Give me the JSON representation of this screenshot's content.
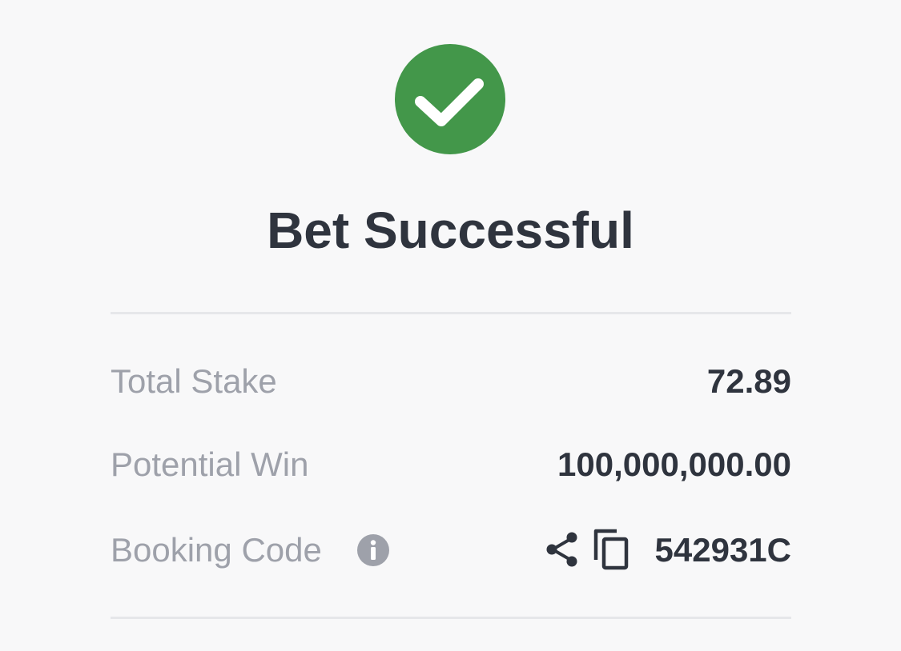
{
  "status": {
    "icon": "checkmark-circle-icon",
    "color": "#43974a",
    "title": "Bet Successful"
  },
  "details": {
    "total_stake_label": "Total Stake",
    "total_stake_value": "72.89",
    "potential_win_label": "Potential Win",
    "potential_win_value": "100,000,000.00",
    "booking_code_label": "Booking Code",
    "booking_code_value": "542931C",
    "booking_icons": [
      "info-icon",
      "share-icon",
      "copy-icon"
    ]
  }
}
